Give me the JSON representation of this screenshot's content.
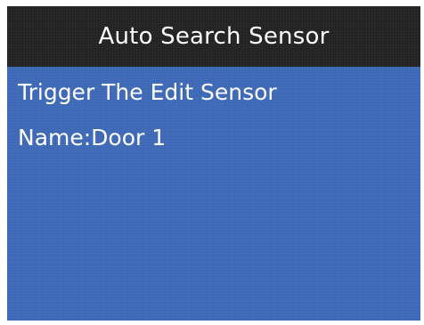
{
  "screen": {
    "title": "Auto Search Sensor",
    "instruction": "Trigger The Edit Sensor",
    "name_line": "Name:Door 1"
  },
  "colors": {
    "title_bar": "#222222",
    "background": "#3c68b5",
    "text": "#ffffff"
  }
}
